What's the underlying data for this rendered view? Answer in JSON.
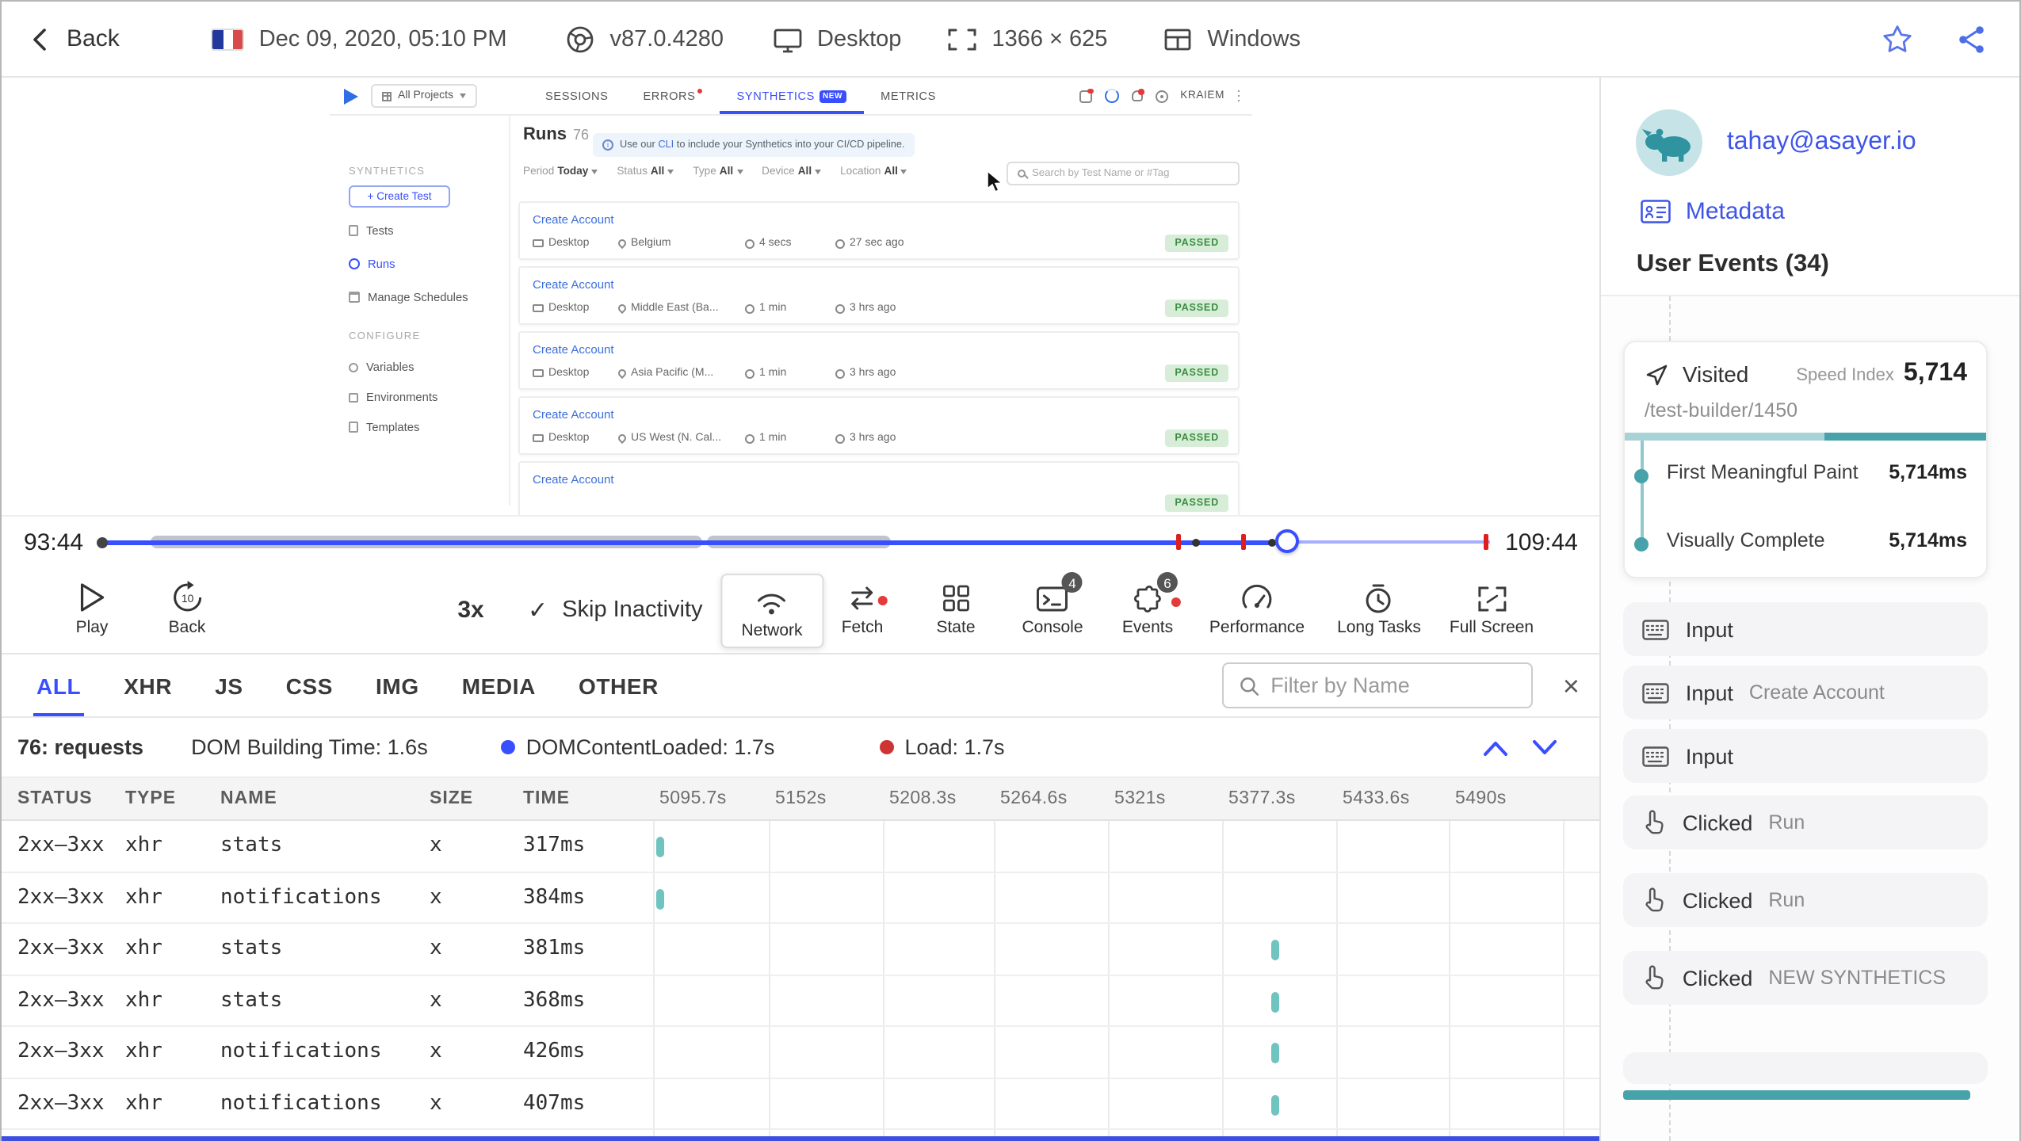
{
  "topbar": {
    "back_label": "Back",
    "date": "Dec 09, 2020, 05:10 PM",
    "browser_version": "v87.0.4280",
    "device": "Desktop",
    "resolution": "1366 × 625",
    "os": "Windows"
  },
  "app": {
    "nav": {
      "projects": "All Projects",
      "sessions": "SESSIONS",
      "errors": "ERRORS",
      "synthetics": "SYNTHETICS",
      "new_badge": "NEW",
      "metrics": "METRICS",
      "user": "KRAIEM"
    },
    "sidebar": {
      "section_synthetics": "SYNTHETICS",
      "create_test": "+ Create Test",
      "tests": "Tests",
      "runs": "Runs",
      "manage_schedules": "Manage Schedules",
      "section_configure": "CONFIGURE",
      "variables": "Variables",
      "environments": "Environments",
      "templates": "Templates"
    },
    "main": {
      "title": "Runs",
      "count": "76",
      "banner_info": "i",
      "banner_pre": "Use our ",
      "banner_cli": "CLI",
      "banner_post": " to include your Synthetics into your CI/CD pipeline.",
      "filters": [
        {
          "label": "Period",
          "value": "Today"
        },
        {
          "label": "Status",
          "value": "All"
        },
        {
          "label": "Type",
          "value": "All"
        },
        {
          "label": "Device",
          "value": "All"
        },
        {
          "label": "Location",
          "value": "All"
        }
      ],
      "search_placeholder": "Search by Test Name or #Tag",
      "runs": [
        {
          "name": "Create Account",
          "device": "Desktop",
          "location": "Belgium",
          "duration": "4 secs",
          "ago": "27 sec ago",
          "status": "PASSED"
        },
        {
          "name": "Create Account",
          "device": "Desktop",
          "location": "Middle East (Ba...",
          "duration": "1 min",
          "ago": "3 hrs ago",
          "status": "PASSED"
        },
        {
          "name": "Create Account",
          "device": "Desktop",
          "location": "Asia Pacific (M...",
          "duration": "1 min",
          "ago": "3 hrs ago",
          "status": "PASSED"
        },
        {
          "name": "Create Account",
          "device": "Desktop",
          "location": "US West (N. Cal...",
          "duration": "1 min",
          "ago": "3 hrs ago",
          "status": "PASSED"
        },
        {
          "name": "Create Account",
          "status": "PASSED"
        }
      ]
    }
  },
  "timeline": {
    "current": "93:44",
    "total": "109:44"
  },
  "controls": {
    "play": "Play",
    "back": "Back",
    "back_amount": "10",
    "speed": "3x",
    "skip_check": "✓",
    "skip_inactivity": "Skip Inactivity",
    "network": "Network",
    "fetch": "Fetch",
    "state": "State",
    "console": "Console",
    "console_badge": "4",
    "events": "Events",
    "events_badge": "6",
    "performance": "Performance",
    "long_tasks": "Long Tasks",
    "full_screen": "Full Screen"
  },
  "network": {
    "tabs": [
      "ALL",
      "XHR",
      "JS",
      "CSS",
      "IMG",
      "MEDIA",
      "OTHER"
    ],
    "filter_placeholder": "Filter by Name",
    "close": "×",
    "stats": {
      "requests": "76: requests",
      "dom_building": "DOM Building Time: 1.6s",
      "dom_content_loaded": "DOMContentLoaded: 1.7s",
      "load": "Load: 1.7s"
    },
    "columns": [
      "STATUS",
      "TYPE",
      "NAME",
      "SIZE",
      "TIME"
    ],
    "ticks": [
      "5095.7s",
      "5152s",
      "5208.3s",
      "5264.6s",
      "5321s",
      "5377.3s",
      "5433.6s",
      "5490s"
    ],
    "rows": [
      {
        "status": "2xx–3xx",
        "type": "xhr",
        "name": "stats",
        "size": "x",
        "time": "317ms"
      },
      {
        "status": "2xx–3xx",
        "type": "xhr",
        "name": "notifications",
        "size": "x",
        "time": "384ms"
      },
      {
        "status": "2xx–3xx",
        "type": "xhr",
        "name": "stats",
        "size": "x",
        "time": "381ms"
      },
      {
        "status": "2xx–3xx",
        "type": "xhr",
        "name": "stats",
        "size": "x",
        "time": "368ms"
      },
      {
        "status": "2xx–3xx",
        "type": "xhr",
        "name": "notifications",
        "size": "x",
        "time": "426ms"
      },
      {
        "status": "2xx–3xx",
        "type": "xhr",
        "name": "notifications",
        "size": "x",
        "time": "407ms"
      }
    ]
  },
  "user_panel": {
    "email": "tahay@asayer.io",
    "metadata": "Metadata",
    "events_title": "User Events (34)",
    "visited": {
      "label": "Visited",
      "speed_label": "Speed Index",
      "speed_value": "5,714",
      "url": "/test-builder/1450",
      "milestones": [
        {
          "label": "First Meaningful Paint",
          "value": "5,714ms"
        },
        {
          "label": "Visually Complete",
          "value": "5,714ms"
        }
      ]
    },
    "events": [
      {
        "label": "Input",
        "value": ""
      },
      {
        "label": "Input",
        "value": "Create Account"
      },
      {
        "label": "Input",
        "value": ""
      },
      {
        "label": "Clicked",
        "value": "Run"
      },
      {
        "label": "Clicked",
        "value": "Run"
      },
      {
        "label": "Clicked",
        "value": "NEW SYNTHETICS"
      }
    ]
  }
}
